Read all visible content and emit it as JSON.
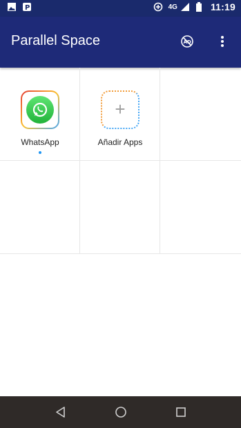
{
  "status_bar": {
    "network": "4G",
    "time": "11:19",
    "icons": [
      "image-icon",
      "parking-icon",
      "data-saver-icon",
      "signal-icon",
      "battery-icon"
    ]
  },
  "app_bar": {
    "title": "Parallel Space",
    "actions": [
      "no-ads-icon",
      "more-vert-icon"
    ]
  },
  "apps": [
    {
      "label": "WhatsApp",
      "icon": "whatsapp-icon",
      "running": true
    },
    {
      "label": "Añadir Apps",
      "icon": "add-icon",
      "running": false
    }
  ],
  "nav_bar": {
    "buttons": [
      "back-icon",
      "home-icon",
      "recents-icon"
    ]
  },
  "colors": {
    "app_bar": "#1e2a78",
    "status_bar": "#1a2a6c",
    "nav_bar": "#2f2a28",
    "running_dot": "#2196f3"
  }
}
